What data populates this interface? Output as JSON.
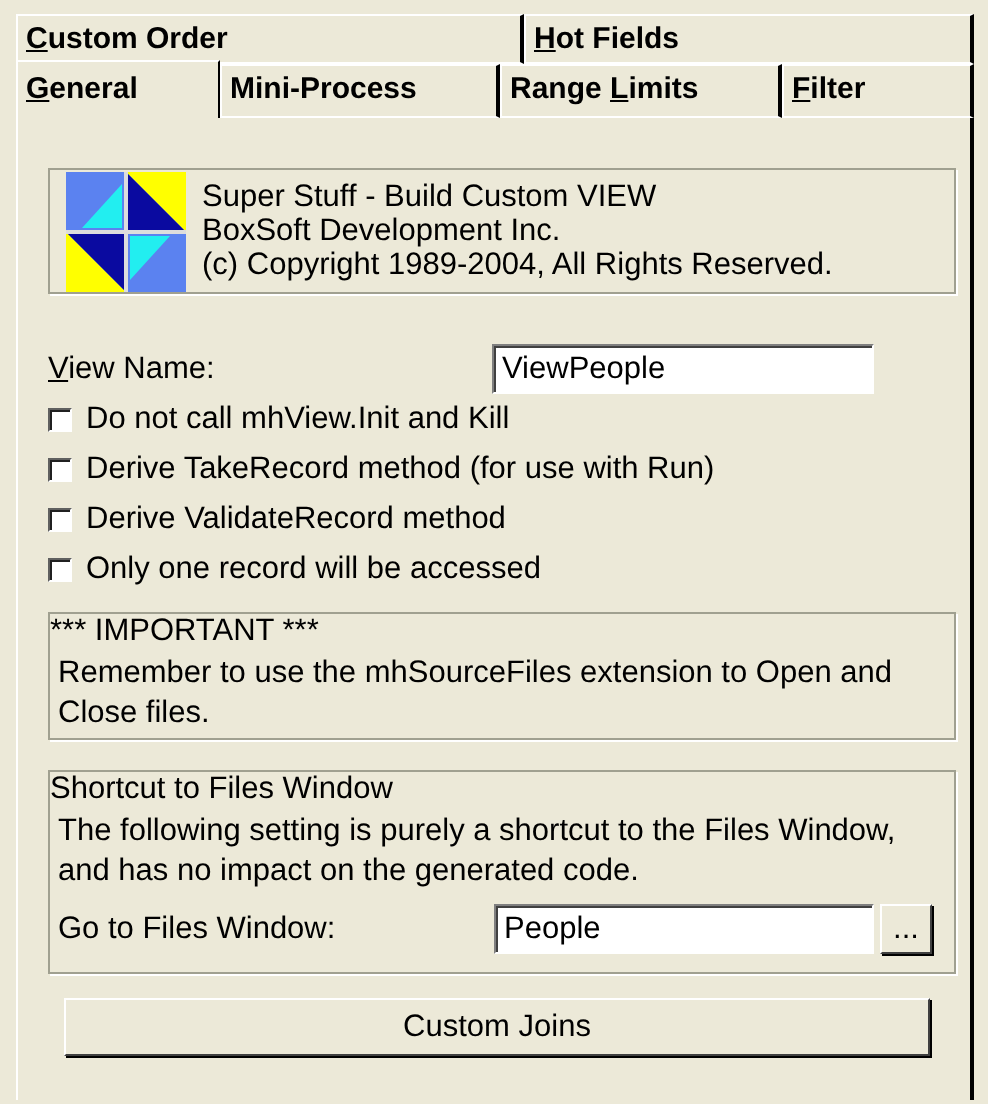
{
  "back_tabs": [
    {
      "access_key": "C",
      "rest": "ustom Order",
      "selected": false
    },
    {
      "access_key": "H",
      "rest": "ot Fields",
      "selected": false
    }
  ],
  "front_tabs": [
    {
      "access_key": "G",
      "rest": "eneral",
      "selected": true
    },
    {
      "text": "Mini-Process",
      "selected": false
    },
    {
      "text": "Range ",
      "access_key": "L",
      "rest": "imits",
      "selected": false
    },
    {
      "access_key": "F",
      "rest": "ilter",
      "selected": false
    }
  ],
  "about": {
    "lines": [
      "Super Stuff - Build Custom VIEW",
      "BoxSoft Development Inc.",
      "(c) Copyright 1989-2004, All Rights Reserved."
    ]
  },
  "view_name": {
    "label": {
      "access_key": "V",
      "rest": "iew Name:"
    },
    "value": "ViewPeople"
  },
  "options": [
    {
      "label": "Do not call mhView.Init and Kill",
      "checked": false
    },
    {
      "label": "Derive TakeRecord method (for use with Run)",
      "checked": false
    },
    {
      "label": "Derive ValidateRecord method",
      "checked": false
    },
    {
      "label": "Only one record will be accessed",
      "checked": false
    }
  ],
  "important": {
    "title": "*** IMPORTANT ***",
    "text": "Remember to use the mhSourceFiles extension to Open and Close files."
  },
  "shortcut": {
    "title": "Shortcut to Files Window",
    "text": "The following setting is purely a shortcut to the Files Window, and has no impact on the generated code.",
    "field_label": "Go to Files Window:",
    "value": "People",
    "browse_button": "..."
  },
  "custom_joins_button": "Custom Joins"
}
